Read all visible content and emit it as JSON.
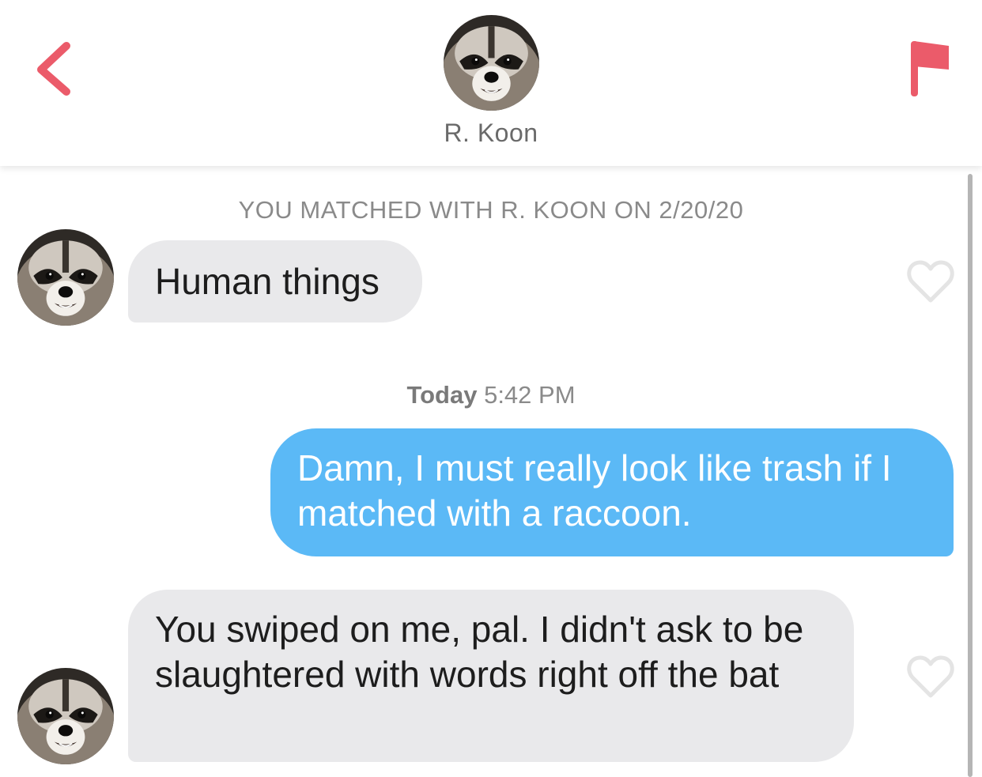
{
  "header": {
    "name": "R. Koon",
    "back_icon": "chevron-left-icon",
    "report_icon": "flag-icon",
    "accent_color": "#eb5b6a"
  },
  "conversation": {
    "match_notice": "YOU MATCHED WITH R. KOON ON 2/20/20",
    "timestamp_day": "Today",
    "timestamp_time": "5:42 PM",
    "messages": [
      {
        "sender": "them",
        "text": "Human things",
        "liked": false
      },
      {
        "sender": "me",
        "text": "Damn, I must really look like trash if I matched with a raccoon."
      },
      {
        "sender": "them",
        "text": "You swiped on me, pal. I didn't ask to be slaughtered with words right off the bat",
        "liked": false
      }
    ]
  },
  "colors": {
    "outgoing_bubble": "#5bb9f6",
    "incoming_bubble": "#e9e9eb",
    "heart_outline": "#e4e4e4"
  }
}
